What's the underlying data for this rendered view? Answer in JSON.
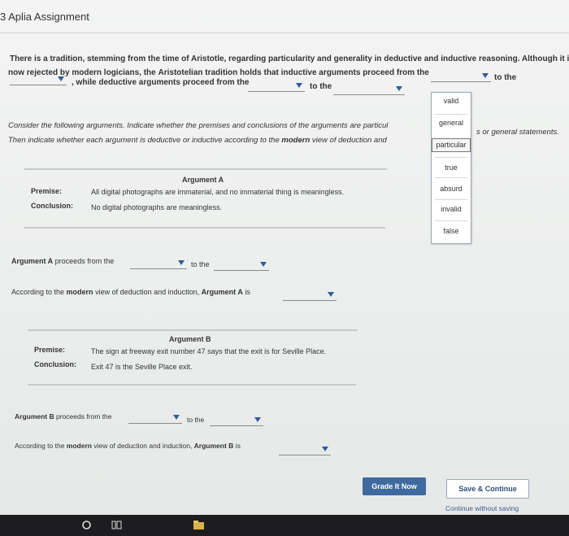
{
  "header": {
    "title": "3 Aplia Assignment"
  },
  "intro": {
    "line1": "There is a tradition, stemming from the time of Aristotle, regarding particularity and generality in deductive and inductive reasoning. Although it is",
    "line2_a": "now rejected by modern logicians, the ",
    "line2_b": "Aristotelian tradition",
    "line2_c": " holds that inductive arguments proceed from the",
    "line2_to": "to the",
    "line3_a": ", while deductive arguments proceed from the",
    "line3_to": "to the"
  },
  "consider": {
    "line1": "Consider the following arguments. Indicate whether the premises and conclusions of the arguments are particul",
    "line1_tail": "s or general statements.",
    "line2_a": "Then indicate whether each argument is deductive or inductive according to the ",
    "line2_b": "modern",
    "line2_c": " view of deduction and"
  },
  "dropdown_popup": {
    "options": [
      "valid",
      "general",
      "particular",
      "true",
      "absurd",
      "invalid",
      "false"
    ],
    "selected": "particular"
  },
  "argument_a": {
    "heading": "Argument A",
    "premise_label": "Premise:",
    "premise": "All digital photographs are immaterial, and no immaterial thing is meaningless.",
    "conclusion_label": "Conclusion:",
    "conclusion": "No digital photographs are meaningless.",
    "proceeds_a": "Argument A",
    "proceeds_b": " proceeds from the",
    "proceeds_to": "to the",
    "modern_a": "According to the ",
    "modern_b": "modern",
    "modern_c": " view of deduction and induction, ",
    "modern_d": "Argument A",
    "modern_e": " is"
  },
  "argument_b": {
    "heading": "Argument B",
    "premise_label": "Premise:",
    "premise": "The sign at freeway exit number 47 says that the exit is for Seville Place.",
    "conclusion_label": "Conclusion:",
    "conclusion": "Exit 47 is the Seville Place exit.",
    "proceeds_a": "Argument B",
    "proceeds_b": " proceeds from the",
    "proceeds_to": "to the",
    "modern_a": "According to the ",
    "modern_b": "modern",
    "modern_c": " view of deduction and induction, ",
    "modern_d": "Argument B",
    "modern_e": " is"
  },
  "actions": {
    "grade_label": "Grade It Now",
    "save_label": "Save & Continue",
    "continue_without_saving": "Continue without saving"
  },
  "taskbar": {
    "icons": [
      "search-icon",
      "task-view-icon",
      "file-explorer-icon"
    ]
  }
}
